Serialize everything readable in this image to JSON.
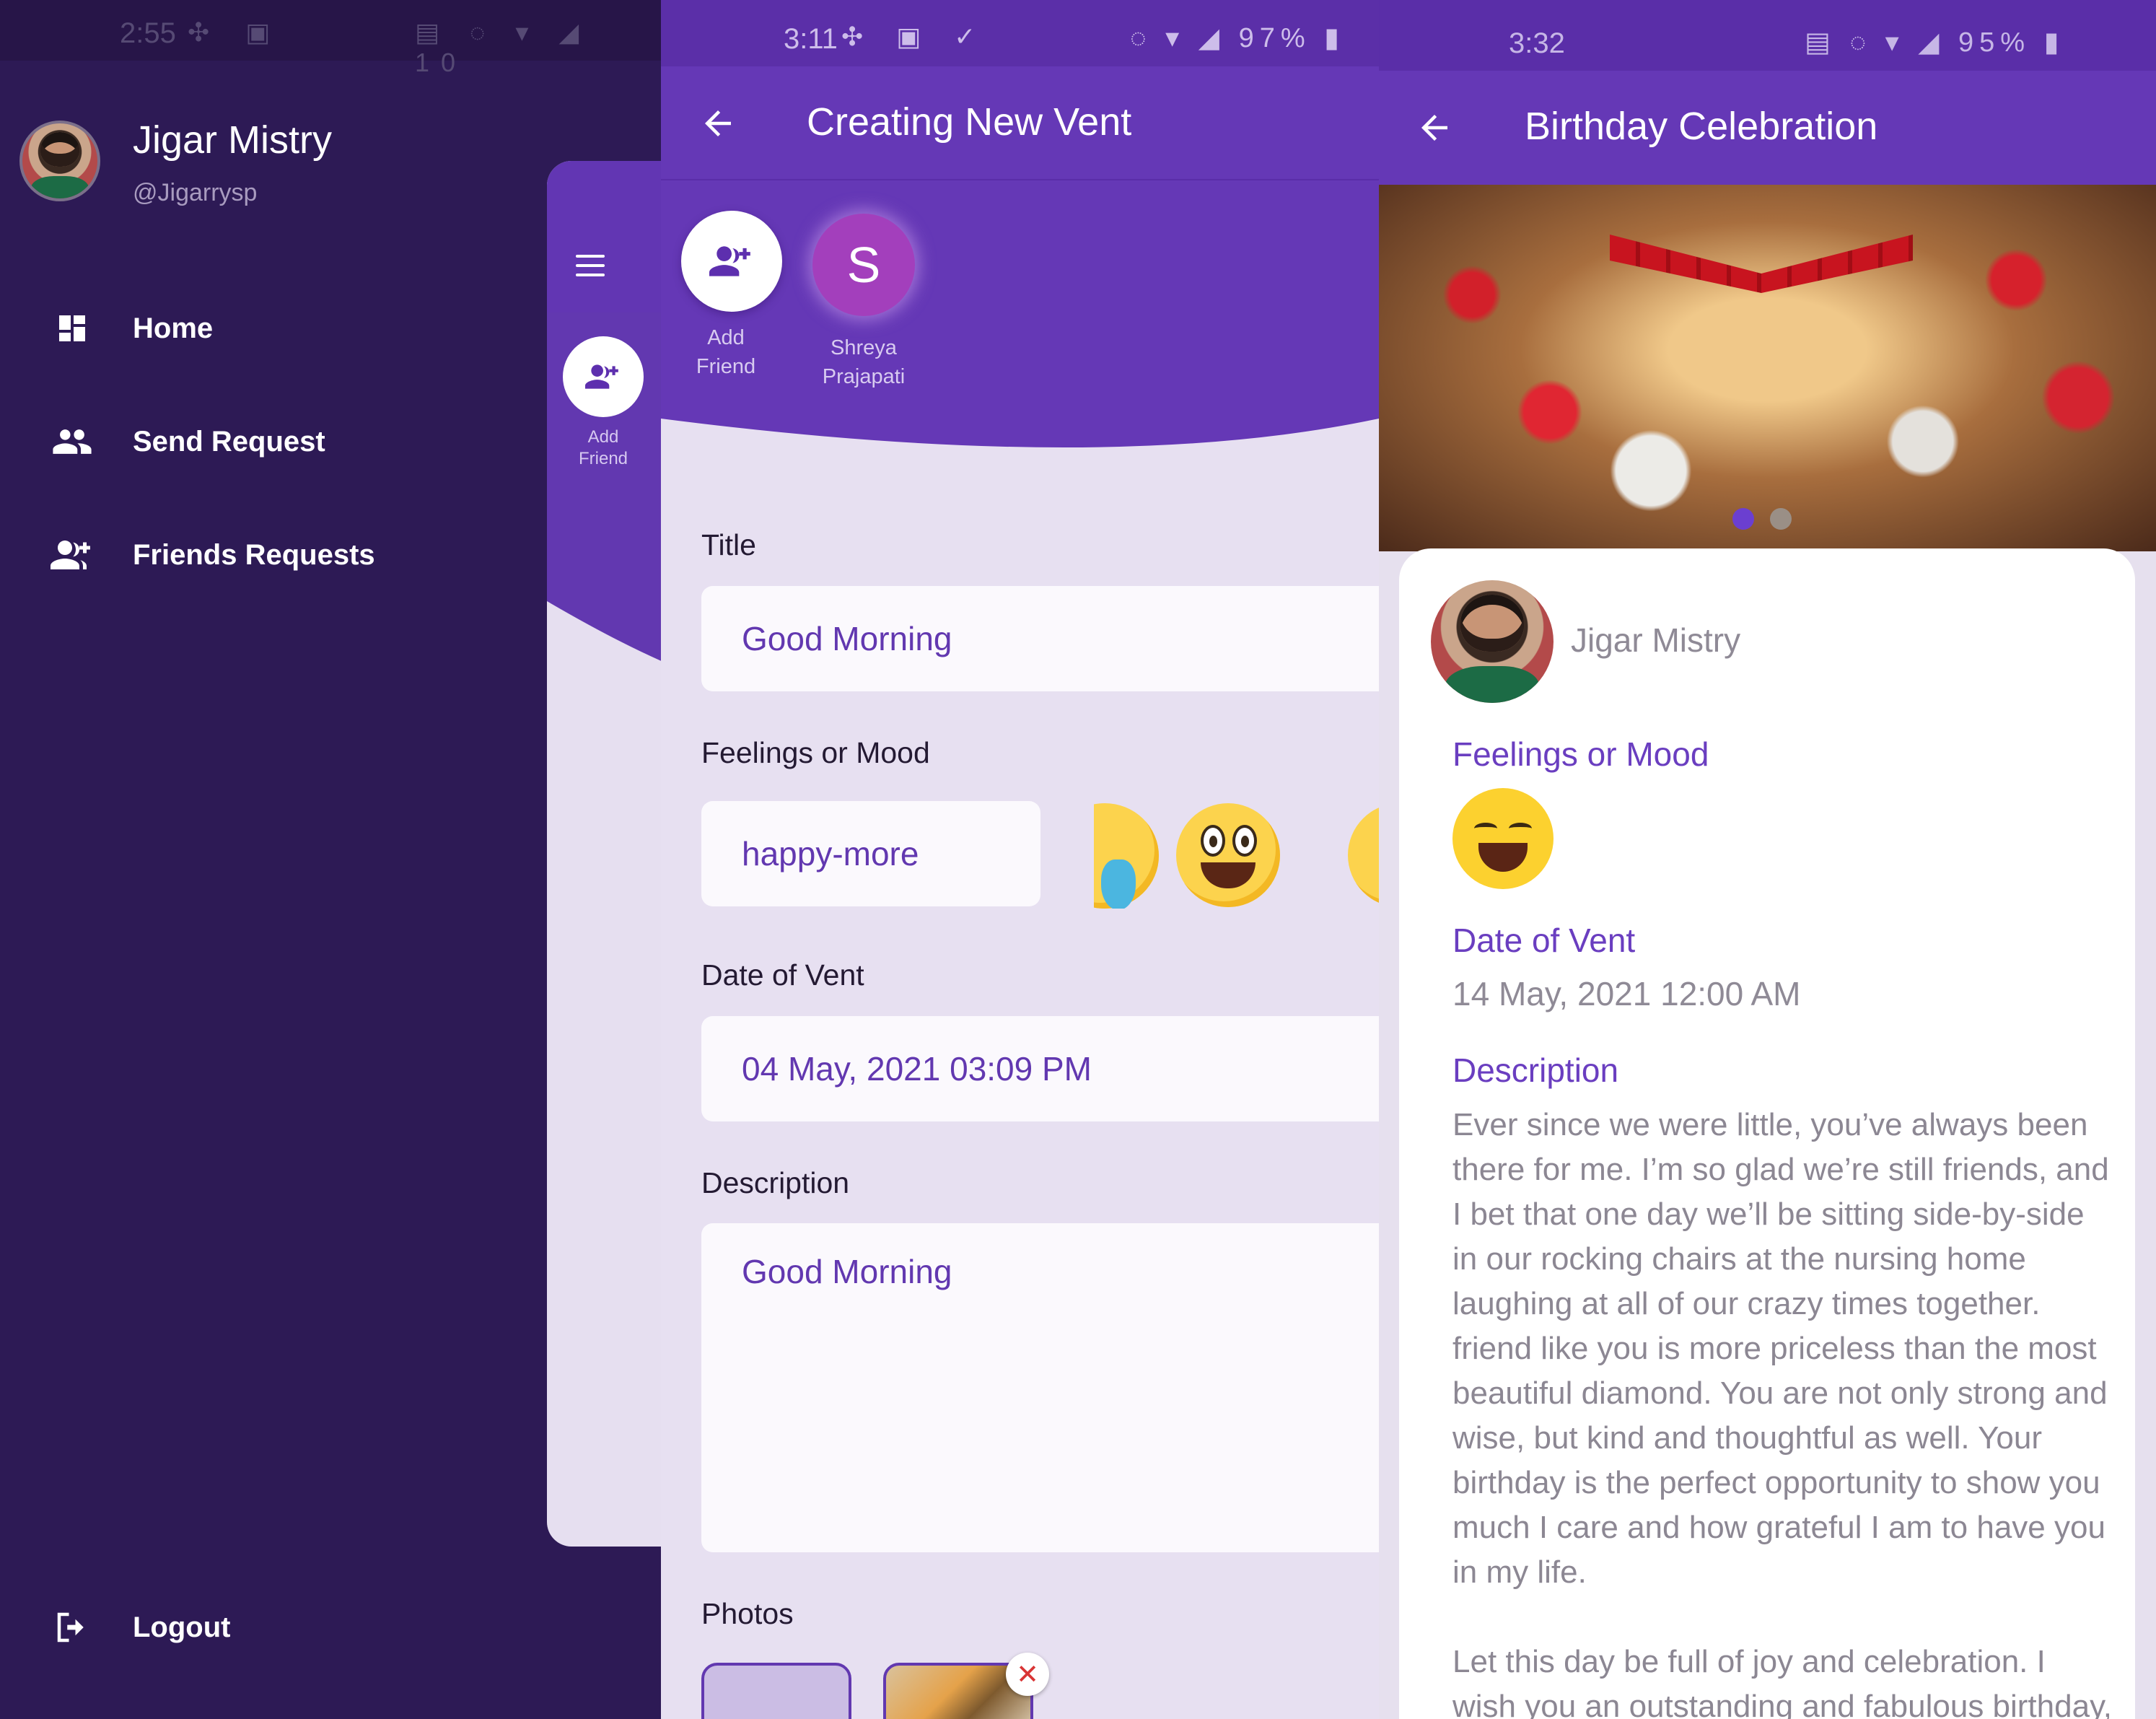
{
  "drawer": {
    "status": {
      "time": "2:55",
      "right": "10"
    },
    "user": {
      "name": "Jigar Mistry",
      "handle": "@Jigarrysp"
    },
    "nav": [
      {
        "label": "Home",
        "icon": "dashboard-icon"
      },
      {
        "label": "Send Request",
        "icon": "people-icon"
      },
      {
        "label": "Friends Requests",
        "icon": "add-people-icon"
      }
    ],
    "logout": {
      "label": "Logout",
      "icon": "logout-icon"
    },
    "peek": {
      "add_friend_line1": "Add",
      "add_friend_line2": "Friend"
    }
  },
  "create_vent": {
    "status": {
      "time": "3:11",
      "battery": "97%"
    },
    "title": "Creating New Vent",
    "friends": [
      {
        "line1": "Add",
        "line2": "Friend",
        "icon": "add-people-icon"
      },
      {
        "initial": "S",
        "line1": "Shreya",
        "line2": "Prajapati"
      }
    ],
    "form": {
      "title_label": "Title",
      "title_value": "Good Morning",
      "mood_label": "Feelings or Mood",
      "mood_value": "happy-more",
      "date_label": "Date of Vent",
      "date_value": "04 May, 2021  03:09 PM",
      "description_label": "Description",
      "description_value": "Good Morning",
      "photos_label": "Photos"
    }
  },
  "vent_detail": {
    "status": {
      "time": "3:32",
      "battery": "95%"
    },
    "title": "Birthday Celebration",
    "author": "Jigar Mistry",
    "mood_label": "Feelings or Mood",
    "date_label": "Date of Vent",
    "date_value": "14 May, 2021 12:00 AM",
    "description_label": "Description",
    "description": "Ever since we were little, you’ve always been there for me. I’m so glad we’re still friends, and I bet that one day we’ll be sitting side-by-side in our rocking chairs at the nursing home laughing at all of our crazy times together.\nfriend like you is more priceless than the most beautiful diamond. You are not only strong and wise, but kind and thoughtful as well. Your birthday is the perfect opportunity to show you much I care and how grateful I am to have you in my life.\n\nLet this day be full of joy and celebration. I wish you an outstanding and fabulous birthday, my",
    "carousel": {
      "pages": 2,
      "active": 1
    }
  },
  "colors": {
    "drawer_bg": "#2d1a55",
    "primary": "#6538b6",
    "accent_text": "#6a3ec0",
    "field_bg": "#fbf9fd",
    "screen_bg": "#e7e0f1"
  }
}
